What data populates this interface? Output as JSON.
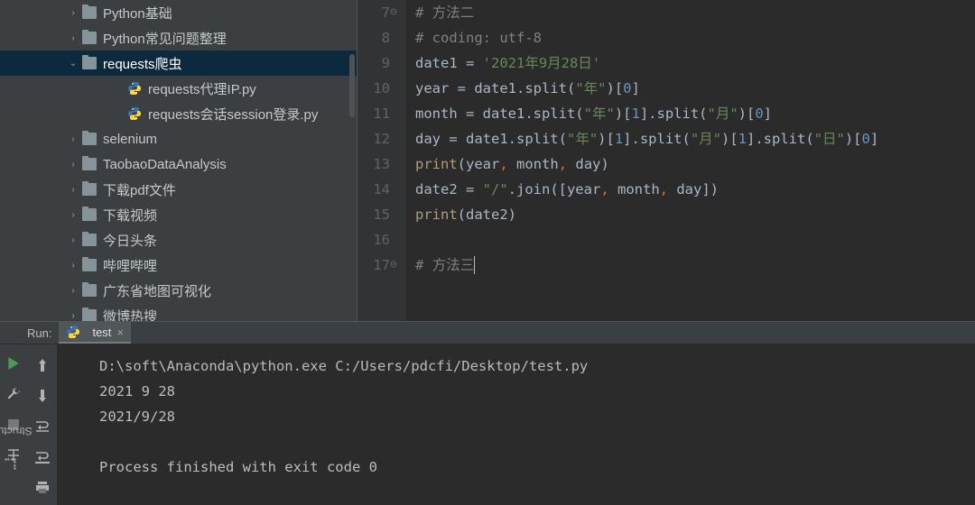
{
  "tree": {
    "items": [
      {
        "indent": 75,
        "chevron": "right",
        "icon": "folder",
        "label": "Python基础"
      },
      {
        "indent": 75,
        "chevron": "right",
        "icon": "folder",
        "label": "Python常见问题整理"
      },
      {
        "indent": 75,
        "chevron": "down",
        "icon": "folder",
        "label": "requests爬虫",
        "selected": true
      },
      {
        "indent": 125,
        "chevron": "",
        "icon": "py",
        "label": "requests代理IP.py"
      },
      {
        "indent": 125,
        "chevron": "",
        "icon": "py",
        "label": "requests会话session登录.py"
      },
      {
        "indent": 75,
        "chevron": "right",
        "icon": "folder",
        "label": "selenium"
      },
      {
        "indent": 75,
        "chevron": "right",
        "icon": "folder",
        "label": "TaobaoDataAnalysis"
      },
      {
        "indent": 75,
        "chevron": "right",
        "icon": "folder",
        "label": "下载pdf文件"
      },
      {
        "indent": 75,
        "chevron": "right",
        "icon": "folder",
        "label": "下载视频"
      },
      {
        "indent": 75,
        "chevron": "right",
        "icon": "folder",
        "label": "今日头条"
      },
      {
        "indent": 75,
        "chevron": "right",
        "icon": "folder",
        "label": "哔哩哔哩"
      },
      {
        "indent": 75,
        "chevron": "right",
        "icon": "folder",
        "label": "广东省地图可视化"
      },
      {
        "indent": 75,
        "chevron": "right",
        "icon": "folder",
        "label": "微博热搜"
      }
    ]
  },
  "editor": {
    "lines": [
      {
        "n": "7",
        "tokens": [
          {
            "c": "cm",
            "t": "# 方法二"
          }
        ],
        "marker": "⊖"
      },
      {
        "n": "8",
        "tokens": [
          {
            "c": "cm",
            "t": "# coding: utf-8"
          }
        ],
        "marker": ""
      },
      {
        "n": "9",
        "tokens": [
          {
            "c": "id",
            "t": "date1 = "
          },
          {
            "c": "str",
            "t": "'2021年9月28日'"
          }
        ]
      },
      {
        "n": "10",
        "tokens": [
          {
            "c": "id",
            "t": "year = date1.split("
          },
          {
            "c": "str",
            "t": "\"年\""
          },
          {
            "c": "id",
            "t": ")["
          },
          {
            "c": "num",
            "t": "0"
          },
          {
            "c": "id",
            "t": "]"
          }
        ]
      },
      {
        "n": "11",
        "tokens": [
          {
            "c": "id",
            "t": "month = date1.split("
          },
          {
            "c": "str",
            "t": "\"年\""
          },
          {
            "c": "id",
            "t": ")["
          },
          {
            "c": "num",
            "t": "1"
          },
          {
            "c": "id",
            "t": "].split("
          },
          {
            "c": "str",
            "t": "\"月\""
          },
          {
            "c": "id",
            "t": ")["
          },
          {
            "c": "num",
            "t": "0"
          },
          {
            "c": "id",
            "t": "]"
          }
        ]
      },
      {
        "n": "12",
        "tokens": [
          {
            "c": "id",
            "t": "day = date1.split("
          },
          {
            "c": "str",
            "t": "\"年\""
          },
          {
            "c": "id",
            "t": ")["
          },
          {
            "c": "num",
            "t": "1"
          },
          {
            "c": "id",
            "t": "].split("
          },
          {
            "c": "str",
            "t": "\"月\""
          },
          {
            "c": "id",
            "t": ")["
          },
          {
            "c": "num",
            "t": "1"
          },
          {
            "c": "id",
            "t": "].split("
          },
          {
            "c": "str",
            "t": "\"日\""
          },
          {
            "c": "id",
            "t": ")["
          },
          {
            "c": "num",
            "t": "0"
          },
          {
            "c": "id",
            "t": "]"
          }
        ]
      },
      {
        "n": "13",
        "tokens": [
          {
            "c": "fn",
            "t": "print"
          },
          {
            "c": "id",
            "t": "(year"
          },
          {
            "c": "kw",
            "t": ","
          },
          {
            "c": "id",
            "t": " month"
          },
          {
            "c": "kw",
            "t": ","
          },
          {
            "c": "id",
            "t": " day)"
          }
        ]
      },
      {
        "n": "14",
        "tokens": [
          {
            "c": "id",
            "t": "date2 = "
          },
          {
            "c": "str",
            "t": "\"/\""
          },
          {
            "c": "id",
            "t": ".join([year"
          },
          {
            "c": "kw",
            "t": ","
          },
          {
            "c": "id",
            "t": " month"
          },
          {
            "c": "kw",
            "t": ","
          },
          {
            "c": "id",
            "t": " day])"
          }
        ]
      },
      {
        "n": "15",
        "tokens": [
          {
            "c": "fn",
            "t": "print"
          },
          {
            "c": "id",
            "t": "(date2)"
          }
        ]
      },
      {
        "n": "16",
        "tokens": []
      },
      {
        "n": "17",
        "tokens": [
          {
            "c": "cm",
            "t": "# 方法三"
          }
        ],
        "marker": "⊖",
        "caret": true
      }
    ]
  },
  "run": {
    "title": "Run:",
    "tab": {
      "label": "test",
      "close": "×"
    },
    "console": [
      "D:\\soft\\Anaconda\\python.exe C:/Users/pdcfi/Desktop/test.py",
      "2021 9 28",
      "2021/9/28",
      "",
      "Process finished with exit code 0"
    ]
  },
  "structure_label": "Structure"
}
